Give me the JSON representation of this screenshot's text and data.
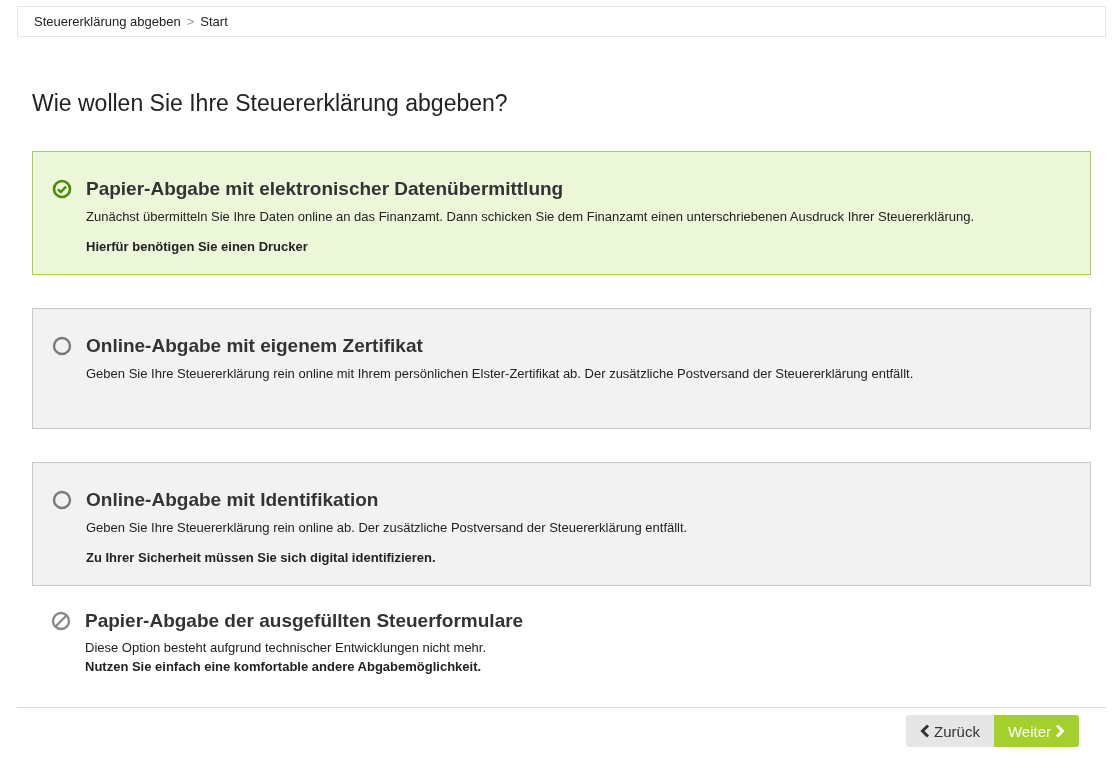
{
  "breadcrumb": [
    {
      "label": "Steuererklärung abgeben"
    },
    {
      "label": "Start"
    }
  ],
  "breadcrumb_separator": ">",
  "heading": "Wie wollen Sie Ihre Steuererklärung abgeben?",
  "options": [
    {
      "kind": "radio",
      "selected": true,
      "title": "Papier-Abgabe mit elektronischer Datenübermittlung",
      "text": "Zunächst übermitteln Sie Ihre Daten online an das Finanzamt. Dann schicken Sie dem Finanzamt einen unterschriebenen Ausdruck Ihrer Steuererklärung.",
      "note": "Hierfür benötigen Sie einen Drucker"
    },
    {
      "kind": "radio",
      "selected": false,
      "title": "Online-Abgabe mit eigenem Zertifikat",
      "text": "Geben Sie Ihre Steuererklärung rein online mit Ihrem persönlichen Elster-Zertifikat ab. Der zusätzliche Postversand der Steuererklärung entfällt."
    },
    {
      "kind": "radio",
      "selected": false,
      "title": "Online-Abgabe mit Identifikation",
      "text": "Geben Sie Ihre Steuererklärung rein online ab. Der zusätzliche Postversand der Steuererklärung entfällt.",
      "note": "Zu Ihrer Sicherheit müssen Sie sich digital identifizieren."
    },
    {
      "kind": "unavailable",
      "title": "Papier-Abgabe der ausgefüllten Steuerformulare",
      "text": "Diese Option besteht aufgrund technischer Entwicklungen nicht mehr.",
      "note": "Nutzen Sie einfach eine komfortable andere Abgabemöglichkeit."
    }
  ],
  "buttons": {
    "back": "Zurück",
    "next": "Weiter"
  }
}
